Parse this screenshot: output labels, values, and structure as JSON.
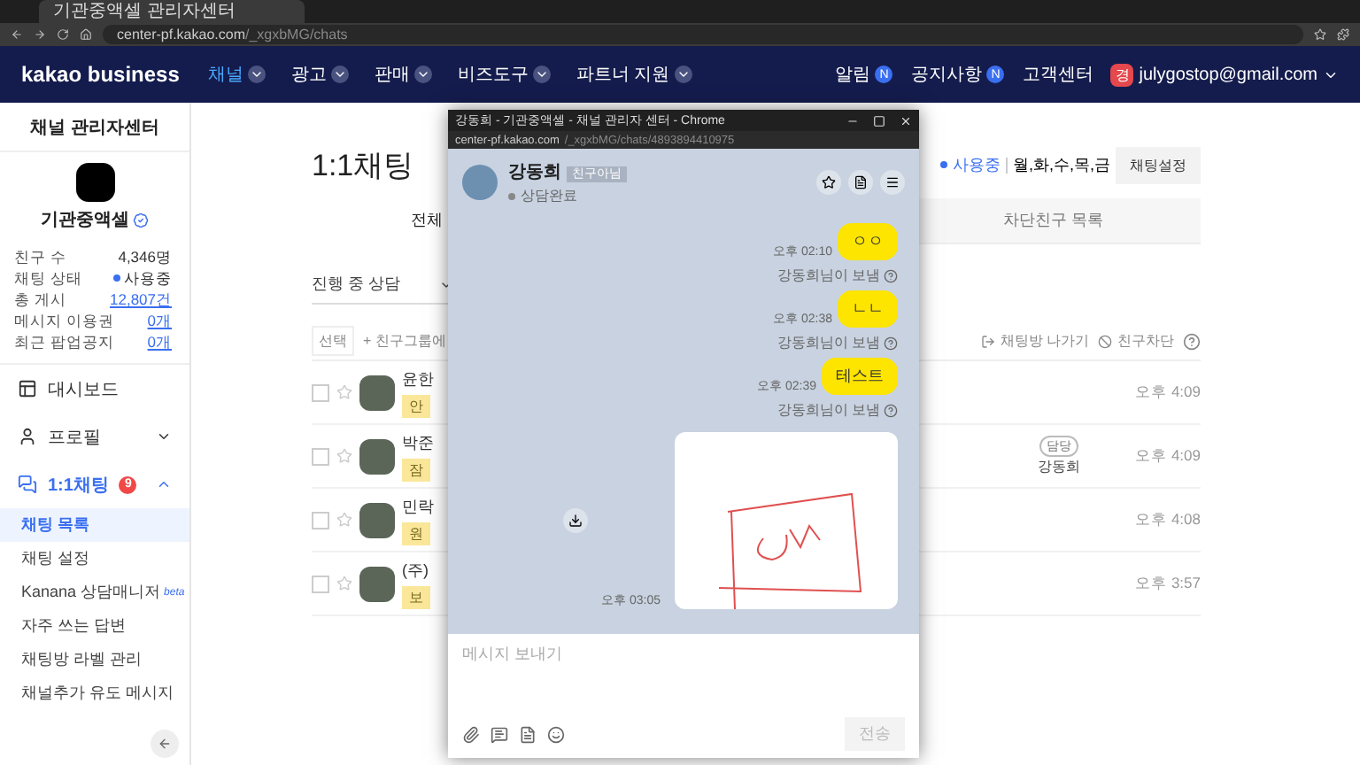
{
  "browser": {
    "tab_title": "기관중액셀 관리자센터",
    "url_host": "center-pf.kakao.com",
    "url_path": "/_xgxbMG/chats"
  },
  "nav": {
    "logo": "kakao business",
    "menus": [
      {
        "label": "채널",
        "selected": true
      },
      {
        "label": "광고",
        "selected": false
      },
      {
        "label": "판매",
        "selected": false
      },
      {
        "label": "비즈도구",
        "selected": false
      },
      {
        "label": "파트너 지원",
        "selected": false
      }
    ],
    "links": [
      {
        "label": "알림",
        "badge": "N"
      },
      {
        "label": "공지사항",
        "badge": "N"
      },
      {
        "label": "고객센터"
      }
    ],
    "account": {
      "initial": "경",
      "email": "julygostop@gmail.com"
    }
  },
  "sidebar": {
    "title": "채널 관리자센터",
    "channel_name": "기관중액셀",
    "stats": [
      {
        "label": "친구 수",
        "value": "4,346명",
        "kind": "plain"
      },
      {
        "label": "채팅 상태",
        "value": "사용중",
        "kind": "status"
      },
      {
        "label": "총 게시",
        "value": "12,807건",
        "kind": "link"
      },
      {
        "label": "메시지 이용권",
        "value": "0개",
        "kind": "link"
      },
      {
        "label": "최근 팝업공지",
        "value": "0개",
        "kind": "link"
      }
    ],
    "menu": [
      {
        "label": "대시보드",
        "selected": false
      },
      {
        "label": "프로필",
        "selected": false,
        "expanded": false
      },
      {
        "label": "1:1채팅",
        "selected": true,
        "expanded": true,
        "badge": "9",
        "children": [
          {
            "label": "채팅 목록",
            "selected": true
          },
          {
            "label": "채팅 설정",
            "selected": false
          },
          {
            "label": "Kanana 상담매니저",
            "tag": "beta",
            "selected": false
          },
          {
            "label": "자주 쓰는 답변",
            "selected": false
          },
          {
            "label": "채팅방 라벨 관리",
            "selected": false
          },
          {
            "label": "채널추가 유도 메시지",
            "selected": false
          }
        ]
      }
    ]
  },
  "main": {
    "title": "1:1채팅",
    "status": "사용중",
    "days": "월,화,수,목,금",
    "settings_button": "채팅설정",
    "tabs": [
      {
        "label": "전체",
        "selected": true
      },
      {
        "label": "차단친구 목록",
        "selected": false
      }
    ],
    "filter": "진행 중 상담",
    "toolbar": {
      "select": "선택",
      "add_group": "+ 친구그룹에",
      "leave": "채팅방 나가기",
      "block": "친구차단"
    },
    "rows": [
      {
        "name": "윤한",
        "preview": "안",
        "time": "오후 4:09",
        "checked": false
      },
      {
        "name": "박준",
        "preview": "잠",
        "time": "오후 4:09",
        "agent": {
          "tag": "담당",
          "name": "강동희"
        },
        "checked": false
      },
      {
        "name": "민락",
        "preview": "원",
        "time": "오후 4:08",
        "checked": false
      },
      {
        "name": "(주)",
        "preview": "보",
        "time": "오후 3:57",
        "checked": false
      }
    ]
  },
  "popup": {
    "title": "강동희 - 기관중액셀 - 채널 관리자 센터 - Chrome",
    "url_host": "center-pf.kakao.com",
    "url_path": "/_xgxbMG/chats/4893894410975",
    "contact": {
      "name": "강동희",
      "tag": "친구아님",
      "status": "상담완료"
    },
    "messages": [
      {
        "kind": "text",
        "text": "ㅇㅇ",
        "time": "오후 02:10",
        "sender": "강동희님이 보냄"
      },
      {
        "kind": "text",
        "text": "ㄴㄴ",
        "time": "오후 02:38",
        "sender": "강동희님이 보냄"
      },
      {
        "kind": "text",
        "text": "테스트",
        "time": "오후 02:39",
        "sender": "강동희님이 보냄"
      },
      {
        "kind": "image",
        "time": "오후 03:05"
      }
    ],
    "input": {
      "placeholder": "메시지 보내기"
    },
    "send_button": "전송"
  }
}
